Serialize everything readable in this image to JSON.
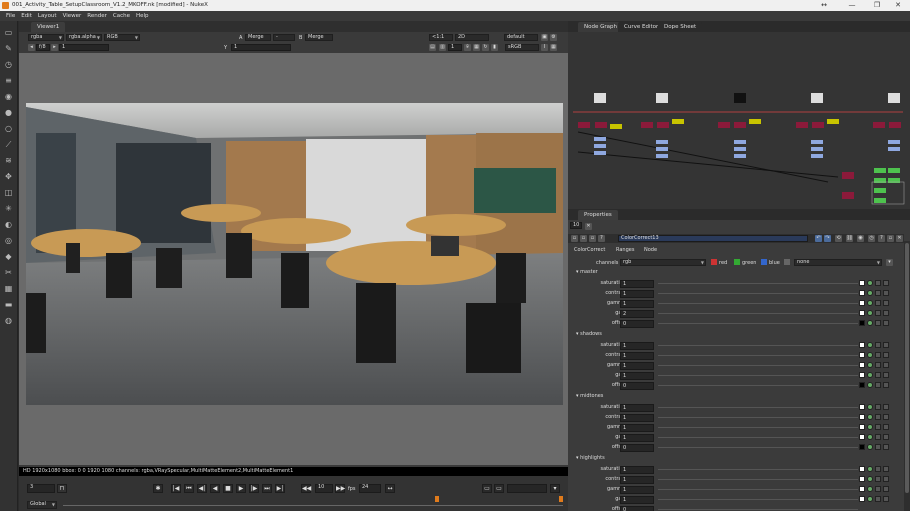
{
  "window": {
    "title": "001_Activity_Table_SetupClassroom_V1.2_MKOFF.nk [modified] - NukeX",
    "controls": [
      "↔",
      "—",
      "❐",
      "✕"
    ]
  },
  "menu": [
    "File",
    "Edit",
    "Layout",
    "Viewer",
    "Render",
    "Cache",
    "Help"
  ],
  "viewer": {
    "tab": "Viewer1",
    "row1": {
      "channels": "rgba",
      "alpha": "rgba.alpha",
      "colorspace": "RGB",
      "a_label": "A",
      "a_input": "Merge",
      "b_sep": "-",
      "b_label": "B",
      "b_input": "Merge",
      "zoom": "<1:1",
      "mode": "2D",
      "lut": "default"
    },
    "row2": {
      "frame_a": "f/8",
      "frame_b": "1",
      "gain_label": "Y",
      "gain": "1",
      "proxy": "1",
      "display": "sRGB"
    },
    "info_bar": "HD 1920x1080  bbox: 0 0 1920 1080  channels: rgba,VRaySpecular,MultiMatteElement2,MultiMatteElement1",
    "timeline": {
      "frame": "3",
      "fps_label": "fps",
      "fps": "24",
      "step": "10",
      "scope": "Global"
    }
  },
  "nodegraph": {
    "tabs": [
      "Node Graph",
      "Curve Editor",
      "Dope Sheet"
    ]
  },
  "properties": {
    "tab": "Properties",
    "max_panels": "10",
    "node_name": "ColorCorrect13",
    "subtabs": [
      "ColorCorrect",
      "Ranges",
      "Node"
    ],
    "channels_label": "channels",
    "channels_value": "rgb",
    "channel_toggles": [
      "red",
      "green",
      "blue"
    ],
    "none_value": "none",
    "groups": [
      {
        "name": "master",
        "rows": [
          {
            "label": "saturation",
            "value": "1"
          },
          {
            "label": "contrast",
            "value": "1"
          },
          {
            "label": "gamma",
            "value": "1"
          },
          {
            "label": "gain",
            "value": "2"
          },
          {
            "label": "offset",
            "value": "0"
          }
        ]
      },
      {
        "name": "shadows",
        "rows": [
          {
            "label": "saturation",
            "value": "1"
          },
          {
            "label": "contrast",
            "value": "1"
          },
          {
            "label": "gamma",
            "value": "1"
          },
          {
            "label": "gain",
            "value": "1"
          },
          {
            "label": "offset",
            "value": "0"
          }
        ]
      },
      {
        "name": "midtones",
        "rows": [
          {
            "label": "saturation",
            "value": "1"
          },
          {
            "label": "contrast",
            "value": "1"
          },
          {
            "label": "gamma",
            "value": "1"
          },
          {
            "label": "gain",
            "value": "1"
          },
          {
            "label": "offset",
            "value": "0"
          }
        ]
      },
      {
        "name": "highlights",
        "rows": [
          {
            "label": "saturation",
            "value": "1"
          },
          {
            "label": "contrast",
            "value": "1"
          },
          {
            "label": "gamma",
            "value": "1"
          },
          {
            "label": "gain",
            "value": "1"
          },
          {
            "label": "offset",
            "value": "0"
          }
        ]
      }
    ]
  },
  "colors": {
    "accent": "#e07b1c",
    "panel_bg": "#3b3b3b",
    "viewport_bg": "#6a6a6a"
  }
}
